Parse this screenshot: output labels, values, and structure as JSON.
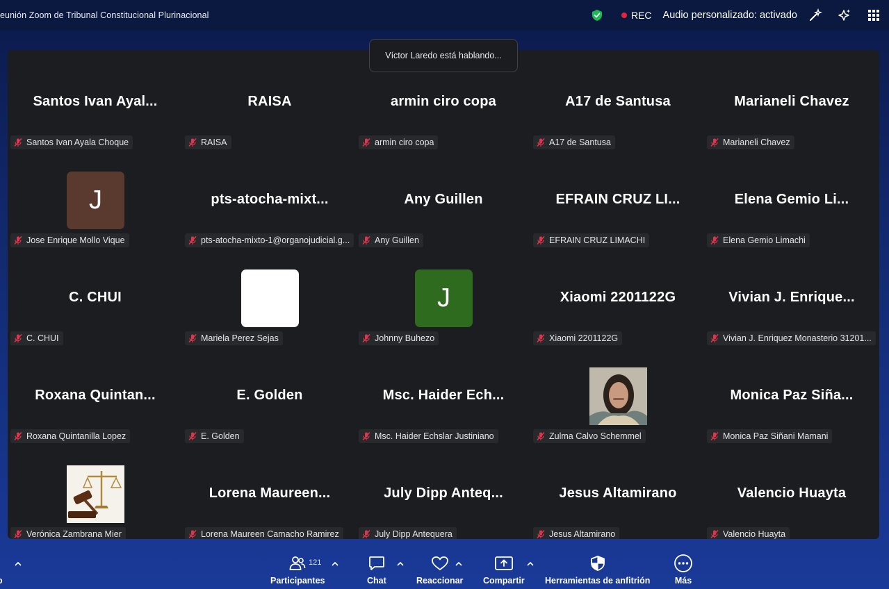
{
  "window": {
    "title": "eunión Zoom de Tribunal Constitucional Plurinacional"
  },
  "status": {
    "rec_label": "REC",
    "audio_label": "Audio personalizado: activado"
  },
  "toast": {
    "text": "Víctor Laredo está hablando..."
  },
  "colors": {
    "rec_red": "#e8243a",
    "shield_green": "#1db954",
    "muted_red": "#e0364b",
    "avatar_brown": "#5a3a2e",
    "avatar_green": "#2f6b1f"
  },
  "participants": [
    {
      "display": "Santos Ivan Ayal...",
      "label": "Santos Ivan Ayala Choque",
      "type": "name"
    },
    {
      "display": "RAISA",
      "label": "RAISA",
      "type": "name"
    },
    {
      "display": "armin ciro copa",
      "label": "armin ciro copa",
      "type": "name"
    },
    {
      "display": "A17 de Santusa",
      "label": "A17 de Santusa",
      "type": "name"
    },
    {
      "display": "Marianeli Chavez",
      "label": "Marianeli Chavez",
      "type": "name"
    },
    {
      "display": "J",
      "label": "Jose Enrique Mollo Vique",
      "type": "avatar",
      "avatar_color": "#5a3a2e"
    },
    {
      "display": "pts-atocha-mixt...",
      "label": "pts-atocha-mixto-1@organojudicial.g...",
      "type": "name"
    },
    {
      "display": "Any Guillen",
      "label": "Any Guillen",
      "type": "name"
    },
    {
      "display": "EFRAIN CRUZ LI...",
      "label": "EFRAIN CRUZ LIMACHI",
      "type": "name"
    },
    {
      "display": "Elena Gemio Li...",
      "label": "Elena Gemio Limachi",
      "type": "name"
    },
    {
      "display": "C. CHUI",
      "label": "C. CHUI",
      "type": "name"
    },
    {
      "display": "",
      "label": "Mariela Perez Sejas",
      "type": "blank"
    },
    {
      "display": "J",
      "label": "Johnny Buhezo",
      "type": "avatar",
      "avatar_color": "#2f6b1f"
    },
    {
      "display": "Xiaomi 2201122G",
      "label": "Xiaomi 2201122G",
      "type": "name"
    },
    {
      "display": "Vivian J. Enrique...",
      "label": "Vivian J. Enriquez Monasterio 31201...",
      "type": "name"
    },
    {
      "display": "Roxana Quintan...",
      "label": "Roxana Quintanilla Lopez",
      "type": "name"
    },
    {
      "display": "E. Golden",
      "label": "E. Golden",
      "type": "name"
    },
    {
      "display": "Msc. Haider Ech...",
      "label": "Msc. Haider Echslar Justiniano",
      "type": "name"
    },
    {
      "display": "",
      "label": "Zulma Calvo Schemmel",
      "type": "photo-person"
    },
    {
      "display": "Monica Paz Siña...",
      "label": "Monica Paz Siñani Mamani",
      "type": "name"
    },
    {
      "display": "",
      "label": "Verónica Zambrana Mier",
      "type": "photo-gavel"
    },
    {
      "display": "Lorena Maureen...",
      "label": "Lorena Maureen Camacho Ramirez",
      "type": "name"
    },
    {
      "display": "July Dipp Anteq...",
      "label": "July Dipp Antequera",
      "type": "name"
    },
    {
      "display": "Jesus Altamirano",
      "label": "Jesus Altamirano",
      "type": "name"
    },
    {
      "display": "Valencio Huayta",
      "label": "Valencio Huayta",
      "type": "name"
    }
  ],
  "toolbar": {
    "left_label": "o",
    "participants_label": "Participantes",
    "participants_count": "121",
    "chat_label": "Chat",
    "react_label": "Reaccionar",
    "share_label": "Compartir",
    "host_tools_label": "Herramientas de anfitrión",
    "more_label": "Más"
  }
}
